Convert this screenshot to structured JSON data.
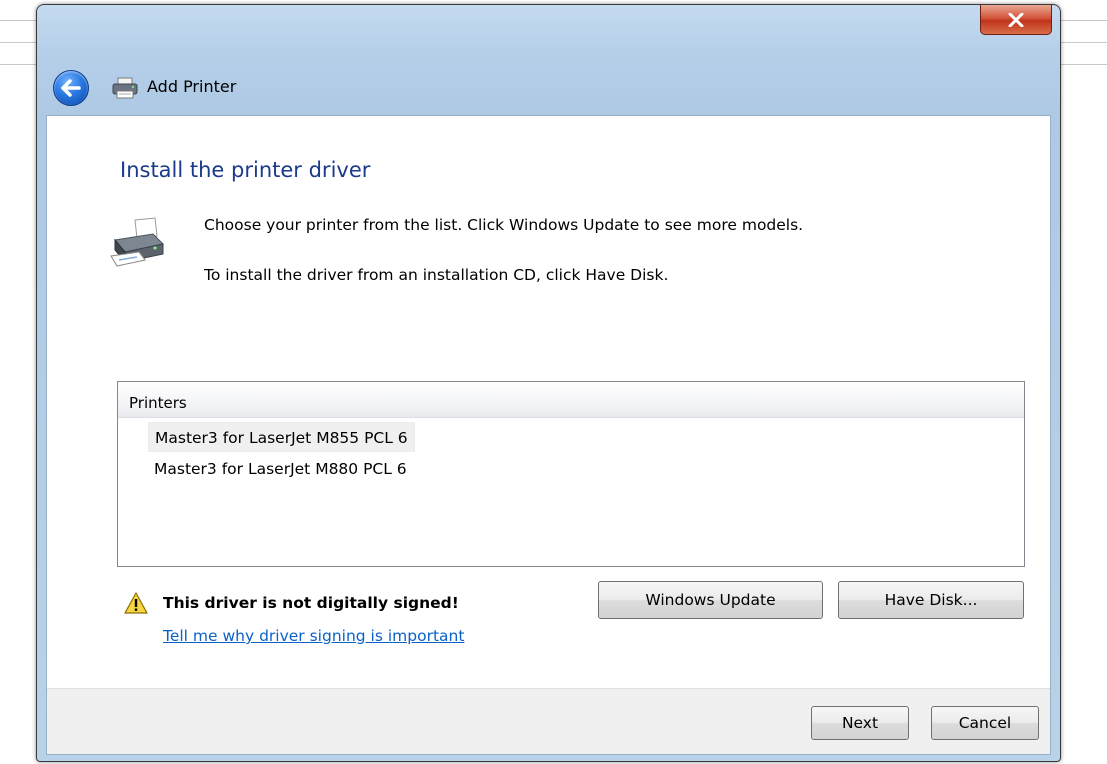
{
  "window": {
    "title": "Add Printer"
  },
  "content": {
    "heading": "Install the printer driver",
    "paragraph1": "Choose your printer from the list. Click Windows Update to see more models.",
    "paragraph2": "To install the driver from an installation CD, click Have Disk."
  },
  "printers_list": {
    "header": "Printers",
    "items": [
      {
        "label": "Master3 for LaserJet M855 PCL 6",
        "selected": true
      },
      {
        "label": "Master3 for LaserJet M880 PCL 6",
        "selected": false
      }
    ]
  },
  "warning": {
    "text": "This driver is not digitally signed!",
    "link": "Tell me why driver signing is important"
  },
  "buttons": {
    "windows_update": "Windows Update",
    "have_disk": "Have Disk...",
    "next": "Next",
    "cancel": "Cancel"
  },
  "icons": {
    "close": "close-icon",
    "back": "back-arrow-icon",
    "title_printer": "printer-icon",
    "content_printer": "printer-icon",
    "warning": "warning-icon"
  },
  "colors": {
    "heading": "#1a3a8c",
    "link": "#0a62c9",
    "close_button": "#c0341b",
    "back_button": "#2a78e2"
  }
}
